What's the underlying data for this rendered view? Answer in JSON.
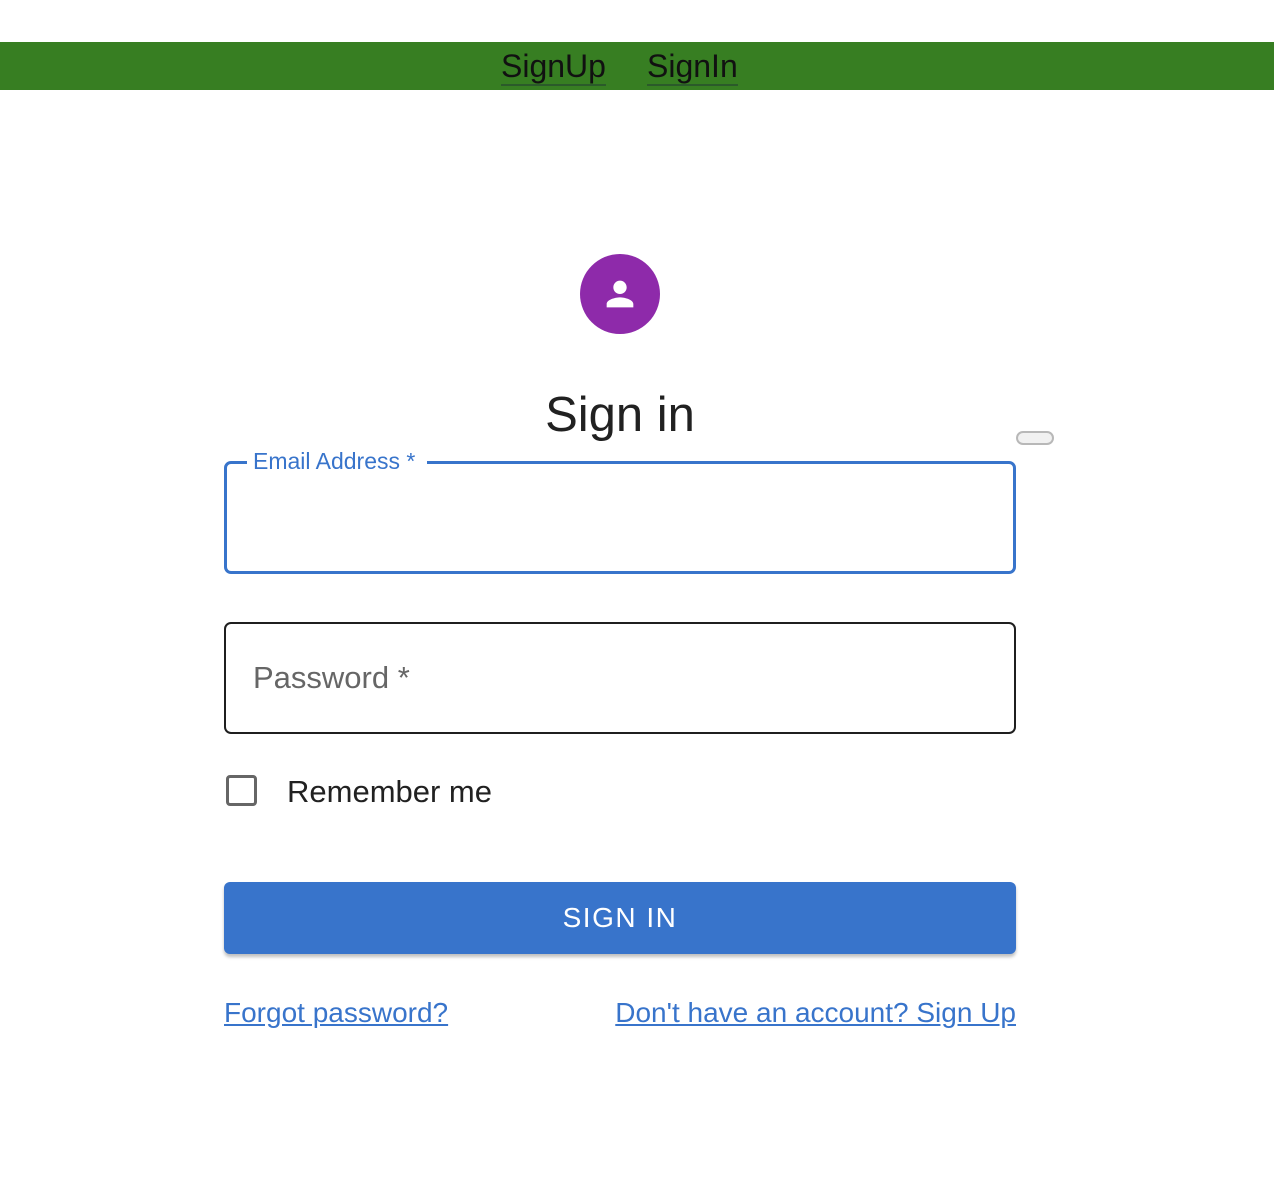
{
  "nav": {
    "signup_label": "SignUp",
    "signin_label": "SignIn",
    "bar_color": "#377e22"
  },
  "avatar": {
    "icon": "person-icon",
    "color": "#8e2aaa"
  },
  "page_title": "Sign in",
  "form": {
    "email_label": "Email Address *",
    "email_value": "",
    "password_label": "Password *",
    "password_value": "",
    "remember_label": "Remember me",
    "remember_checked": false,
    "submit_label": "SIGN IN",
    "accent_color": "#3874cb"
  },
  "links": {
    "forgot": "Forgot password?",
    "signup": "Don't have an account? Sign Up"
  }
}
